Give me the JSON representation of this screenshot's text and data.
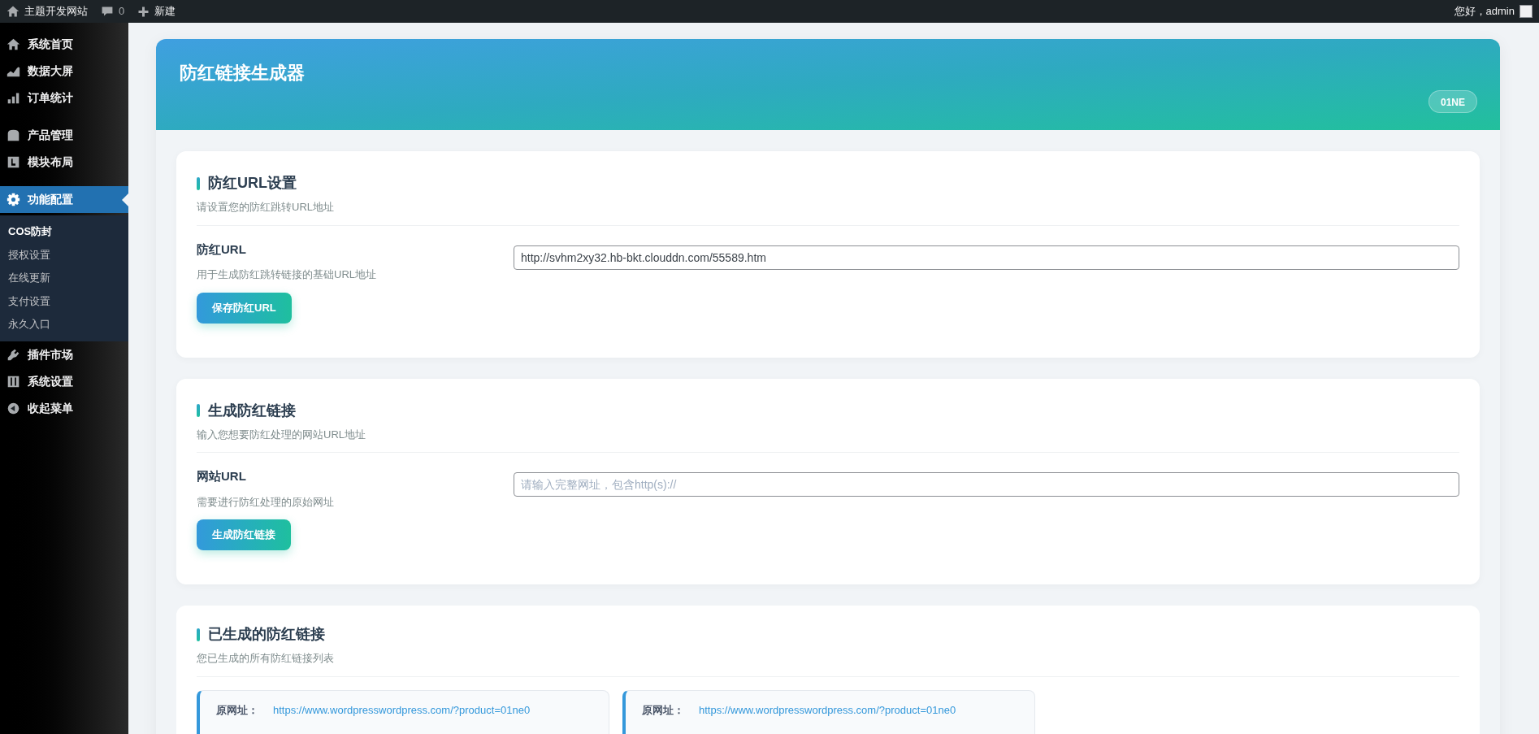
{
  "top_bar": {
    "site_name": "主题开发网站",
    "comments_count": "0",
    "new_label": "新建",
    "greeting": "您好，admin"
  },
  "sidebar": {
    "groups": [
      [
        {
          "label": "系统首页",
          "selected": false
        },
        {
          "label": "数据大屏",
          "selected": false
        },
        {
          "label": "订单统计",
          "selected": false
        }
      ],
      [
        {
          "label": "产品管理",
          "selected": false
        },
        {
          "label": "模块布局",
          "selected": false
        }
      ],
      [
        {
          "label": "功能配置",
          "selected": true,
          "children": [
            {
              "label": "COS防封",
              "selected": true
            },
            {
              "label": "授权设置",
              "selected": false
            },
            {
              "label": "在线更新",
              "selected": false
            },
            {
              "label": "支付设置",
              "selected": false
            },
            {
              "label": "永久入口",
              "selected": false
            }
          ]
        },
        {
          "label": "插件市场",
          "selected": false
        },
        {
          "label": "系统设置",
          "selected": false
        },
        {
          "label": "收起菜单",
          "selected": false
        }
      ]
    ]
  },
  "header": {
    "title": "防红链接生成器",
    "badge": "01NE"
  },
  "sections": [
    {
      "title": "防红URL设置",
      "description": "请设置您的防红跳转URL地址",
      "field_label": "防红URL",
      "field_help": "用于生成防红跳转链接的基础URL地址",
      "value": "http://svhm2xy32.hb-bkt.clouddn.com/55589.htm",
      "button": "保存防红URL"
    },
    {
      "title": "生成防红链接",
      "description": "输入您想要防红处理的网站URL地址",
      "field_label": "网站URL",
      "field_help": "需要进行防红处理的原始网址",
      "placeholder": "请输入完整网址，包含http(s)://",
      "button": "生成防红链接"
    }
  ],
  "generated": {
    "title": "已生成的防红链接",
    "description": "您已生成的所有防红链接列表",
    "links": [
      {
        "label": "原网址：",
        "url": "https://www.wordpresswordpress.com/?product=01ne0"
      },
      {
        "label": "原网址：",
        "url": "https://www.wordpresswordpress.com/?product=01ne0"
      }
    ]
  }
}
